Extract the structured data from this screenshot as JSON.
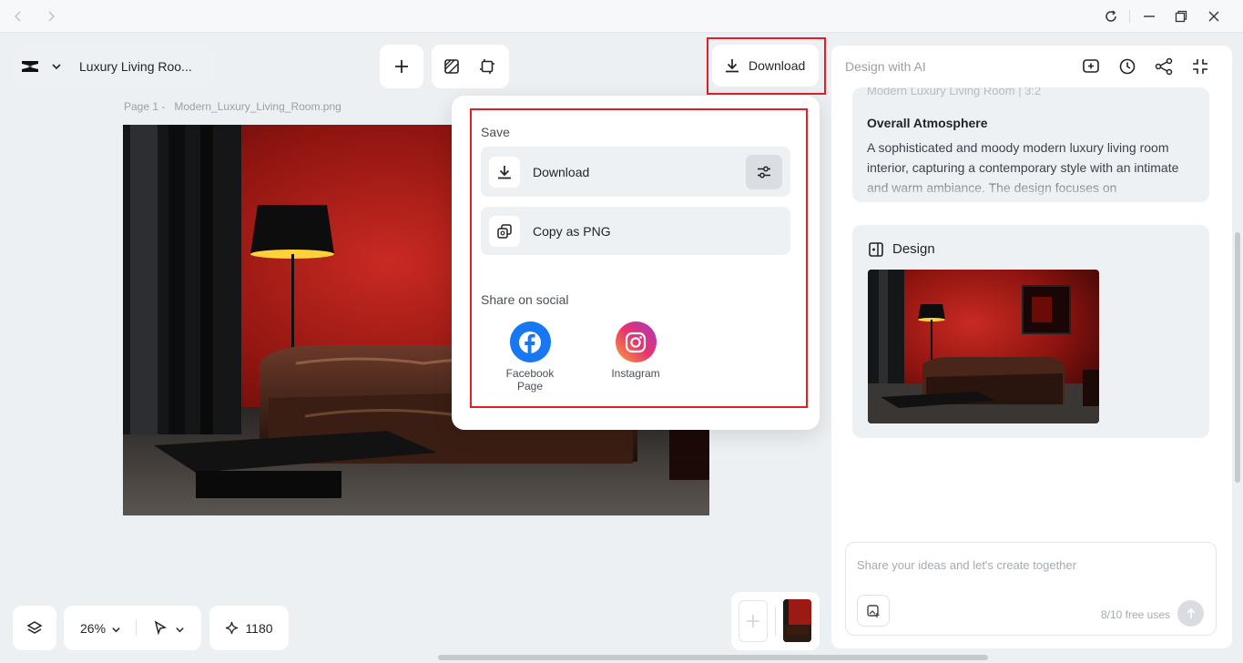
{
  "titlebar": {
    "icons": [
      "back-arrow-icon",
      "forward-arrow-icon",
      "refresh-icon",
      "minimize-icon",
      "restore-icon",
      "close-icon"
    ]
  },
  "project": {
    "title": "Luxury Living Roo..."
  },
  "page_label": "Page 1 -   Modern_Luxury_Living_Room.png",
  "download_button": {
    "label": "Download"
  },
  "download_menu": {
    "save_heading": "Save",
    "download_label": "Download",
    "copy_label": "Copy as PNG",
    "social_heading": "Share on social",
    "facebook_label_1": "Facebook",
    "facebook_label_2": "Page",
    "instagram_label": "Instagram",
    "highlight_color": "#e01f26"
  },
  "ai_panel": {
    "title": "Design with AI",
    "faded_text": "Modern Luxury Living Room | 3:2",
    "atmosphere_heading": "Overall Atmosphere",
    "atmosphere_text": "A sophisticated and moody modern luxury living room interior, capturing a contemporary style with an intimate and warm ambiance. The design focuses on",
    "design_heading": "Design",
    "prompt_placeholder": "Share your ideas and let's create together",
    "free_uses": "8/10 free uses"
  },
  "bottom_bar": {
    "zoom": "26%",
    "credits": "1180"
  }
}
